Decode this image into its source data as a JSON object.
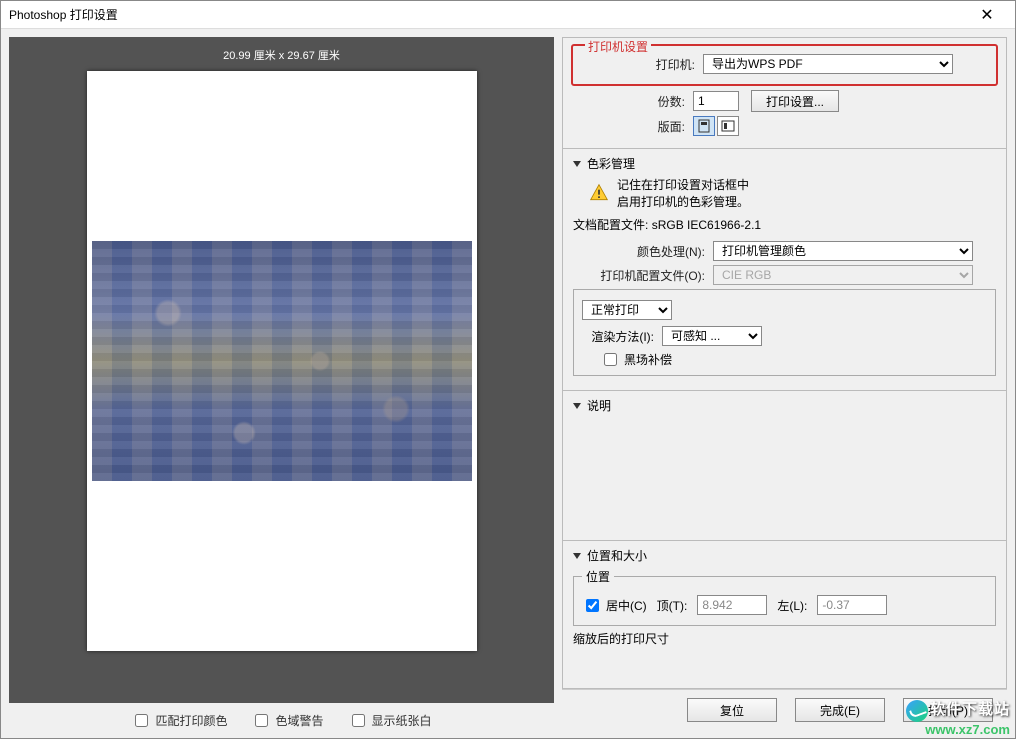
{
  "window": {
    "title": "Photoshop 打印设置"
  },
  "preview": {
    "dimensions": "20.99 厘米 x 29.67 厘米"
  },
  "left_checks": {
    "match_print_colors": "匹配打印颜色",
    "gamut_warning": "色域警告",
    "show_paper_white": "显示纸张白"
  },
  "printer_setup": {
    "legend": "打印机设置",
    "printer_label": "打印机:",
    "printer_value": "导出为WPS PDF",
    "copies_label": "份数:",
    "copies_value": "1",
    "print_settings_btn": "打印设置...",
    "layout_label": "版面:"
  },
  "color_mgmt": {
    "title": "色彩管理",
    "warn_line1": "记住在打印设置对话框中",
    "warn_line2": "启用打印机的色彩管理。",
    "doc_profile_label": "文档配置文件:",
    "doc_profile_value": "sRGB IEC61966-2.1",
    "handling_label": "颜色处理(N):",
    "handling_value": "打印机管理颜色",
    "printer_profile_label": "打印机配置文件(O):",
    "printer_profile_value": "CIE RGB",
    "normal_print": "正常打印",
    "rendering_label": "渲染方法(I):",
    "rendering_value": "可感知   ...",
    "black_point": "黑场补偿"
  },
  "description": {
    "title": "说明"
  },
  "position": {
    "title": "位置和大小",
    "pos_legend": "位置",
    "center_label": "居中(C)",
    "top_label": "顶(T):",
    "top_value": "8.942",
    "left_label": "左(L):",
    "left_value": "-0.37",
    "scaled_label": "缩放后的打印尺寸"
  },
  "buttons": {
    "reset": "复位",
    "done": "完成(E)",
    "print": "打印(P)"
  },
  "watermark": {
    "top": "软件下载站",
    "bottom": "www.xz7.com"
  }
}
